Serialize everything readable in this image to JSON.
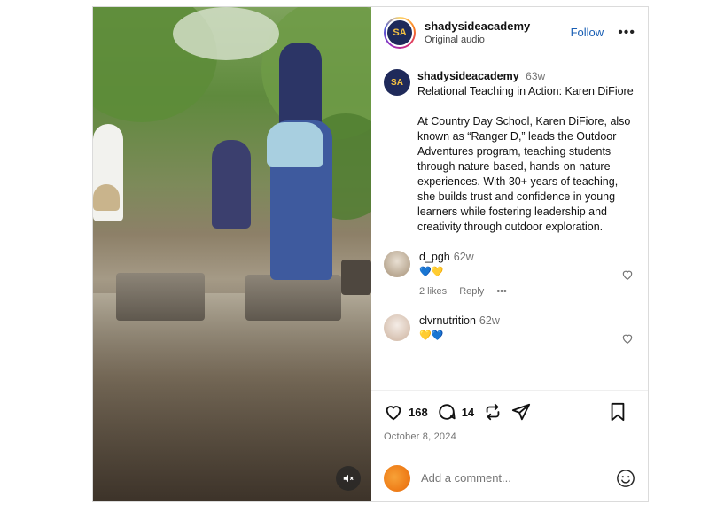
{
  "post": {
    "account": {
      "username": "shadysideacademy",
      "subtitle": "Original audio",
      "follow_label": "Follow",
      "more_label": "•••",
      "avatar_initials": "SA"
    },
    "caption": {
      "username": "shadysideacademy",
      "age": "63w",
      "title": "Relational Teaching in Action: Karen DiFiore",
      "body": "At Country Day School, Karen DiFiore, also known as “Ranger D,” leads the Outdoor Adventures program, teaching students through nature-based, hands-on nature experiences. With 30+ years of teaching, she builds trust and confidence in young learners while fostering leadership and creativity through outdoor exploration."
    },
    "comments": [
      {
        "username": "d_pgh",
        "age": "62w",
        "text": "💙💛",
        "likes": "2 likes",
        "reply": "Reply",
        "more": "•••"
      },
      {
        "username": "clvrnutrition",
        "age": "62w",
        "text": "💛💙"
      }
    ],
    "actions": {
      "like_count": "168",
      "comment_count": "14",
      "date": "October 8, 2024"
    },
    "add_comment": {
      "placeholder": "Add a comment..."
    }
  },
  "colors": {
    "accent": "#1a5fb4",
    "muted": "#737373",
    "border": "#dbdbdb"
  },
  "icons": [
    "heart-icon",
    "comment-icon",
    "repost-icon",
    "share-icon",
    "bookmark-icon",
    "emoji-icon",
    "mute-icon"
  ]
}
